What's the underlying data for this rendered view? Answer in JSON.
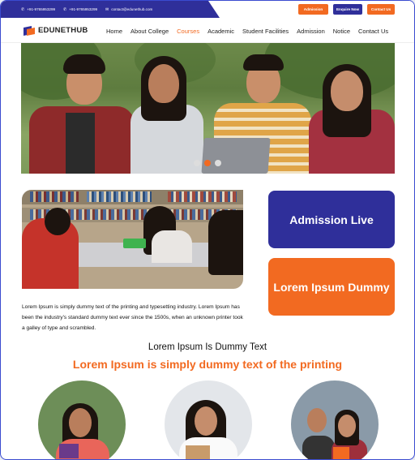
{
  "topbar": {
    "phone1": "+91-9765953299",
    "phone2": "+91-9765953299",
    "email": "contact@edunethub.com",
    "admission_btn": "Admission",
    "enquire_btn": "Enquire Now",
    "contact_btn": "Contact Us"
  },
  "nav": {
    "logo": "EDUNETHUB",
    "items": [
      "Home",
      "About College",
      "Courses",
      "Academic",
      "Student Facilities",
      "Admission",
      "Notice",
      "Contact Us"
    ],
    "active": "Courses"
  },
  "hero": {
    "slide_count": 3,
    "active_slide": 2
  },
  "about": {
    "text": "Lorem Ipsum is simply dummy text of the printing and typesetting industry. Lorem Ipsum has been the industry's standard dummy text ever since the 1500s, when an unknown printer took a galley of type and scrambled."
  },
  "cards": {
    "admission_live": "Admission Live",
    "lorem_dummy": "Lorem Ipsum Dummy"
  },
  "section": {
    "heading": "Lorem Ipsum Is Dummy Text",
    "subheading": "Lorem Ipsum is simply dummy text of the printing"
  },
  "colors": {
    "primary": "#2f2f9a",
    "accent": "#f26a21"
  },
  "icons": {
    "phone": "phone-icon",
    "email": "mail-icon"
  }
}
